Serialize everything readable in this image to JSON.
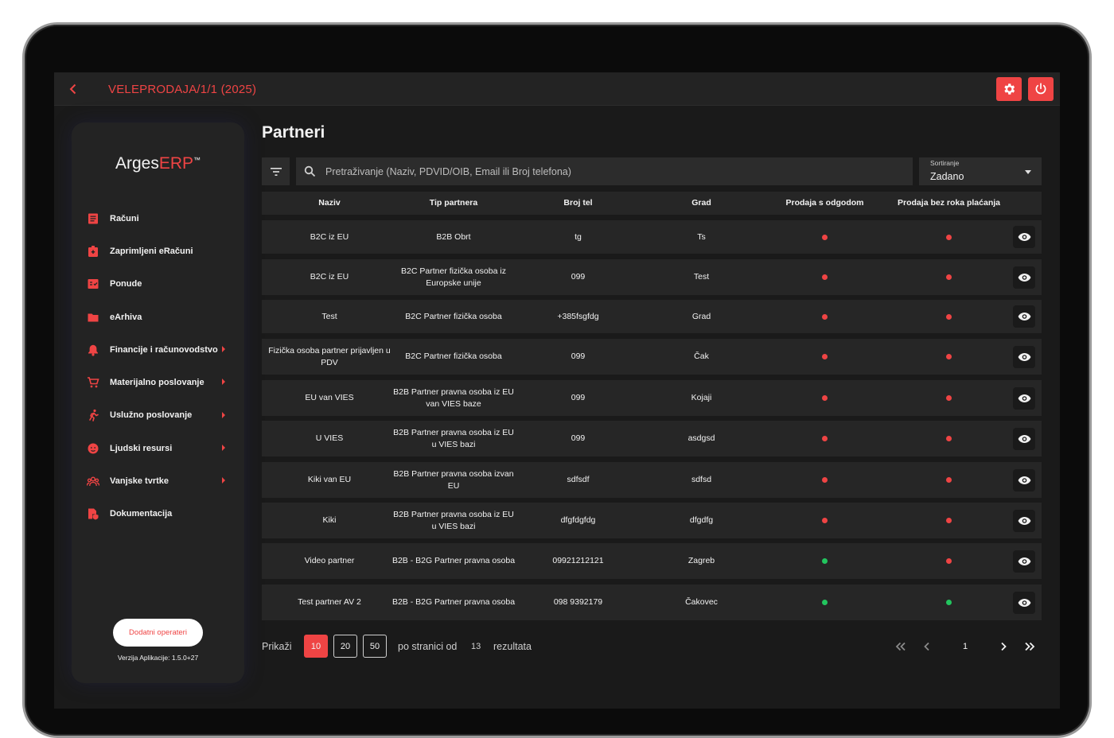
{
  "header": {
    "title": "VELEPRODAJA/1/1 (2025)"
  },
  "colors": {
    "accent": "#ef4444",
    "green": "#22c55e",
    "red": "#ef4444"
  },
  "sidebar": {
    "logo": {
      "main": "Arges",
      "accent": "ERP",
      "tm": "™"
    },
    "items": [
      {
        "label": "Računi",
        "icon": "receipt-icon",
        "has_submenu": false
      },
      {
        "label": "Zaprimljeni eRačuni",
        "icon": "inbox-icon",
        "has_submenu": false
      },
      {
        "label": "Ponude",
        "icon": "offer-icon",
        "has_submenu": false
      },
      {
        "label": "eArhiva",
        "icon": "folder-icon",
        "has_submenu": false
      },
      {
        "label": "Financije i računovodstvo",
        "icon": "bell-icon",
        "has_submenu": true
      },
      {
        "label": "Materijalno poslovanje",
        "icon": "cart-icon",
        "has_submenu": true
      },
      {
        "label": "Uslužno poslovanje",
        "icon": "runner-icon",
        "has_submenu": true
      },
      {
        "label": "Ljudski resursi",
        "icon": "face-icon",
        "has_submenu": true
      },
      {
        "label": "Vanjske tvrtke",
        "icon": "group-icon",
        "has_submenu": true
      },
      {
        "label": "Dokumentacija",
        "icon": "doc-shield-icon",
        "has_submenu": false
      }
    ],
    "operators_button": "Dodatni operateri",
    "version": "Verzija Aplikacije: 1.5.0+27"
  },
  "main": {
    "title": "Partneri",
    "search": {
      "placeholder": "Pretraživanje (Naziv, PDVID/OIB, Email ili Broj telefona)"
    },
    "sort": {
      "label": "Sortiranje",
      "value": "Zadano"
    },
    "table": {
      "columns": [
        "Naziv",
        "Tip partnera",
        "Broj tel",
        "Grad",
        "Prodaja s odgodom",
        "Prodaja bez roka plaćanja"
      ],
      "rows": [
        {
          "naziv": "B2C iz EU",
          "tip": "B2B Obrt",
          "tel": "tg",
          "grad": "Ts",
          "odgoda": "red",
          "bez_roka": "red"
        },
        {
          "naziv": "B2C iz EU",
          "tip": "B2C Partner fizička osoba iz Europske unije",
          "tel": "099",
          "grad": "Test",
          "odgoda": "red",
          "bez_roka": "red"
        },
        {
          "naziv": "Test",
          "tip": "B2C Partner fizička osoba",
          "tel": "+385fsgfdg",
          "grad": "Grad",
          "odgoda": "red",
          "bez_roka": "red"
        },
        {
          "naziv": "Fizička osoba partner prijavljen u PDV",
          "tip": "B2C Partner fizička osoba",
          "tel": "099",
          "grad": "Čak",
          "odgoda": "red",
          "bez_roka": "red"
        },
        {
          "naziv": "EU van VIES",
          "tip": "B2B Partner pravna osoba iz EU van VIES baze",
          "tel": "099",
          "grad": "Kojaji",
          "odgoda": "red",
          "bez_roka": "red"
        },
        {
          "naziv": "U VIES",
          "tip": "B2B Partner pravna osoba iz EU u VIES bazi",
          "tel": "099",
          "grad": "asdgsd",
          "odgoda": "red",
          "bez_roka": "red"
        },
        {
          "naziv": "Kiki van EU",
          "tip": "B2B Partner pravna osoba izvan EU",
          "tel": "sdfsdf",
          "grad": "sdfsd",
          "odgoda": "red",
          "bez_roka": "red"
        },
        {
          "naziv": "Kiki",
          "tip": "B2B Partner pravna osoba iz EU u VIES bazi",
          "tel": "dfgfdgfdg",
          "grad": "dfgdfg",
          "odgoda": "red",
          "bez_roka": "red"
        },
        {
          "naziv": "Video partner",
          "tip": "B2B - B2G Partner pravna osoba",
          "tel": "09921212121",
          "grad": "Zagreb",
          "odgoda": "green",
          "bez_roka": "red"
        },
        {
          "naziv": "Test partner AV 2",
          "tip": "B2B - B2G Partner pravna osoba",
          "tel": "098 9392179",
          "grad": "Čakovec",
          "odgoda": "green",
          "bez_roka": "green"
        }
      ]
    },
    "pagination": {
      "show_label": "Prikaži",
      "page_sizes": [
        "10",
        "20",
        "50"
      ],
      "active_size": "10",
      "per_page_label": "po stranici od",
      "total": "13",
      "results_label": "rezultata",
      "current_page": "1"
    }
  }
}
